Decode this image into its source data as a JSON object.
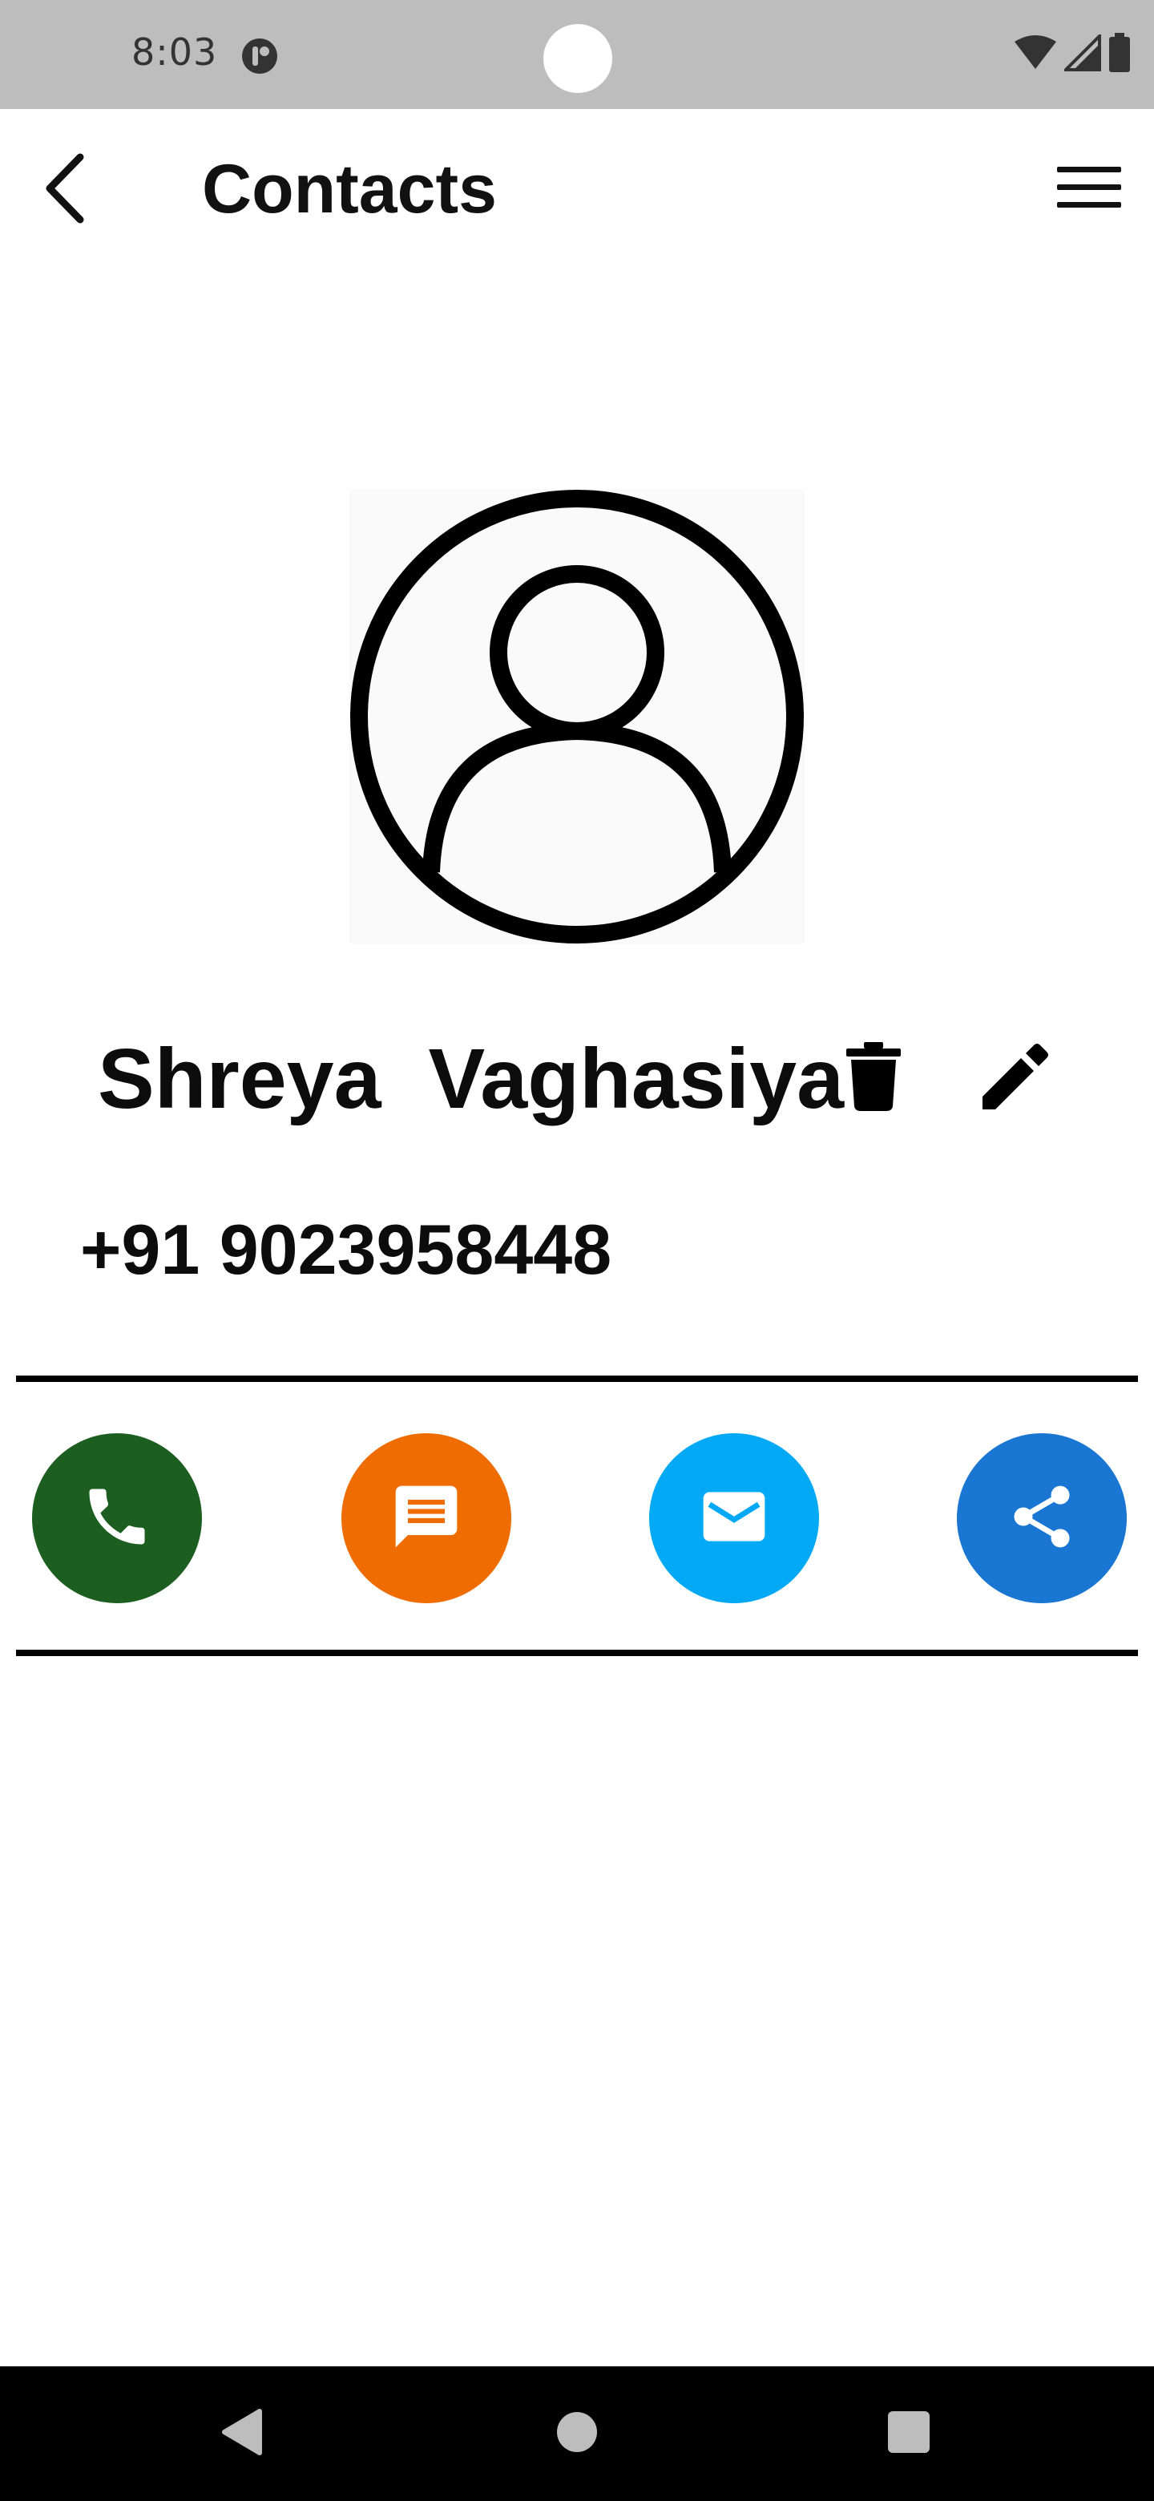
{
  "status_bar": {
    "time": "8:03",
    "background": "#bdbdbd",
    "icons": [
      "app-notification-icon",
      "wifi-icon",
      "cellular-signal-icon",
      "battery-icon"
    ]
  },
  "app_bar": {
    "title": "Contacts",
    "back_icon": "chevron-left-icon",
    "menu_icon": "hamburger-menu-icon"
  },
  "contact": {
    "avatar_icon": "account-circle-icon",
    "name": "Shreya  Vaghasiya",
    "phone": "+91 9023958448",
    "delete_icon": "trash-icon",
    "edit_icon": "pencil-icon"
  },
  "actions": [
    {
      "name": "call",
      "icon": "phone-icon",
      "color": "#1b5e20"
    },
    {
      "name": "message",
      "icon": "message-icon",
      "color": "#ef6c00"
    },
    {
      "name": "email",
      "icon": "email-icon",
      "color": "#03a9f4"
    },
    {
      "name": "share",
      "icon": "share-icon",
      "color": "#1976d2"
    }
  ],
  "nav_bar": {
    "background": "#000000",
    "icons": [
      "nav-back-icon",
      "nav-home-icon",
      "nav-recents-icon"
    ]
  }
}
